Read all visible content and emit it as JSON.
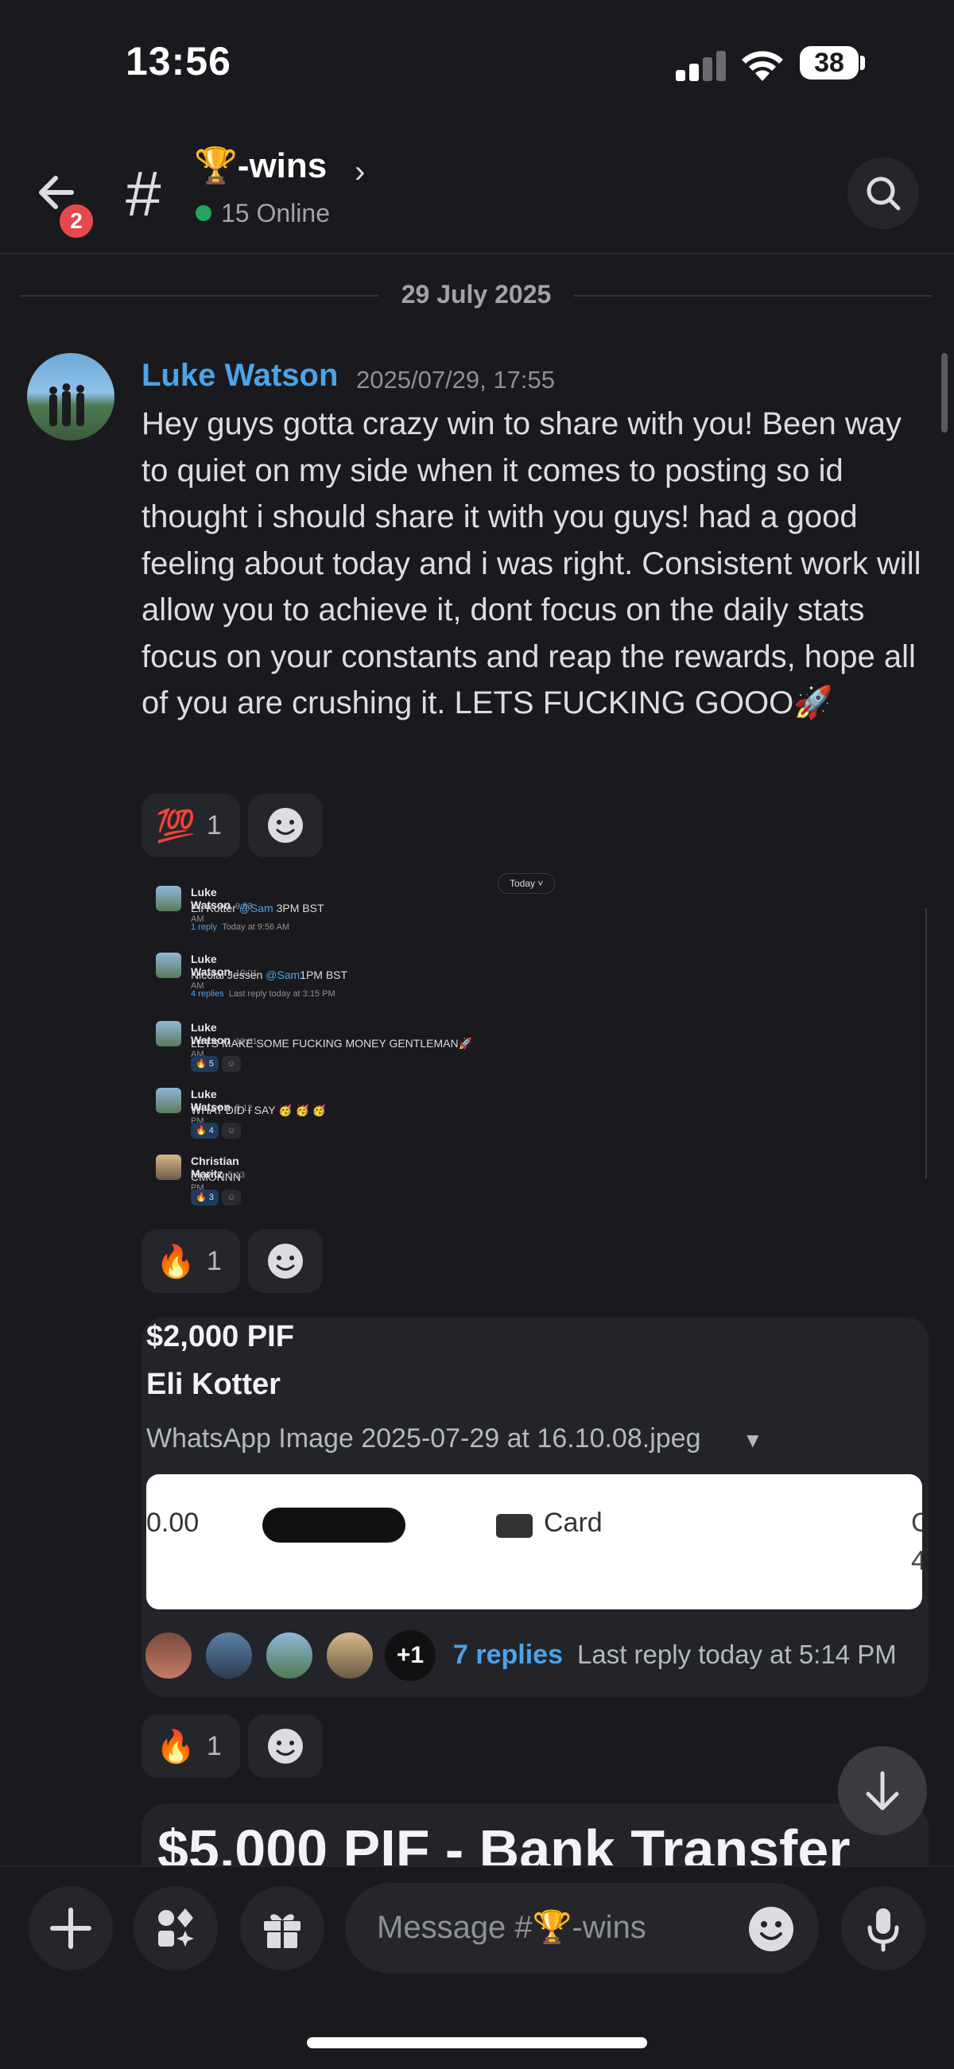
{
  "status_bar": {
    "time": "13:56",
    "battery": "38"
  },
  "header": {
    "notification_count": "2",
    "channel_prefix": "#",
    "channel_name": "🏆-wins",
    "chevron": "›",
    "online": "15 Online"
  },
  "date_separator": "29 July 2025",
  "message": {
    "author": "Luke Watson",
    "timestamp": "2025/07/29, 17:55",
    "text": "Hey guys gotta crazy win to share with you! Been way to quiet on my side when it comes to posting so id thought i should share it with you guys! had a good feeling about today and i was right. Consistent work will allow you to achieve it, dont focus on the daily stats focus on your constants and reap the rewards, hope all of you are crushing it. LETS FUCKING GOOO🚀",
    "reaction1": {
      "emoji": "💯",
      "count": "1"
    },
    "reaction2": {
      "emoji": "🔥",
      "count": "1"
    },
    "reaction3": {
      "emoji": "🔥",
      "count": "1"
    }
  },
  "embedded_screenshot": {
    "today": "Today ˅",
    "rows": [
      {
        "name": "Luke Watson",
        "time": "9:53 AM",
        "pre": "Eli Kotter ",
        "mention": "@Sam",
        "post": " 3PM BST",
        "thread_link": "1 reply",
        "thread_meta": "Today at 9:56 AM"
      },
      {
        "name": "Luke Watson",
        "time": "10:01 AM",
        "pre": "Nicolai Jessen ",
        "mention": "@Sam",
        "post": "1PM BST",
        "thread_link": "4 replies",
        "thread_meta": "Last reply today at 3:15 PM"
      },
      {
        "name": "Luke Watson",
        "time": "10:01 AM",
        "text": "LETS MAKE SOME FUCKING MONEY GENTLEMAN🚀",
        "reaction": "🔥 5"
      },
      {
        "name": "Luke Watson",
        "time": "5:12 PM",
        "text": "WHAT DID I SAY 🥳 🥳 🥳",
        "reaction": "🔥 4"
      },
      {
        "name": "Christian Maritz",
        "time": "5:13 PM",
        "text": "CMONNN",
        "reaction": "🔥 3"
      }
    ]
  },
  "thread_card": {
    "title1": "$2,000 PIF",
    "title2": "Eli Kotter",
    "file_name": "WhatsApp Image 2025-07-29 at 16.10.08.jpeg",
    "image_left": "0.00",
    "image_card": "Card",
    "image_right1": "C",
    "image_right2": "4",
    "more_participants": "+1",
    "replies": "7 replies",
    "last_reply": "Last reply today at 5:14 PM"
  },
  "next_card_title": "$5,000 PIF - Bank Transfer",
  "composer": {
    "placeholder": "Message #🏆-wins"
  },
  "colors": {
    "accent": "#4ca3e8",
    "online": "#23a55a",
    "badge": "#e5484d",
    "background": "#1a1a1e"
  }
}
